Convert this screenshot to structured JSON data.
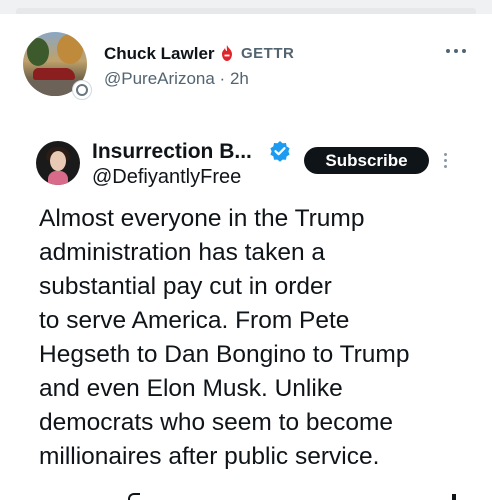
{
  "outer_post": {
    "author_name": "Chuck Lawler",
    "platform_label": "GETTR",
    "handle": "@PureArizona",
    "separator": "·",
    "time": "2h",
    "icons": {
      "gettr": "gettr-flame-icon",
      "more": "more-horizontal-icon",
      "avatar_badge": "profile-badge-icon"
    },
    "colors": {
      "gettr_accent": "#e0252b",
      "meta_text": "#536471"
    }
  },
  "embedded_post": {
    "author_name": "Insurrection B...",
    "handle": "@DefiyantlyFree",
    "subscribe_label": "Subscribe",
    "verified_icon": "verified-badge-icon",
    "more_icon": "more-vertical-icon",
    "body_lines": [
      "Almost everyone in the Trump",
      "administration has taken a",
      "substantial pay cut in order",
      "to serve America. From Pete",
      "Hegseth to Dan Bongino to Trump",
      "and even Elon Musk. Unlike",
      "democrats who seem to become",
      "millionaires after public service."
    ],
    "colors": {
      "verified": "#1d9bf0",
      "button_bg": "#0f1419",
      "button_text": "#ffffff"
    }
  }
}
